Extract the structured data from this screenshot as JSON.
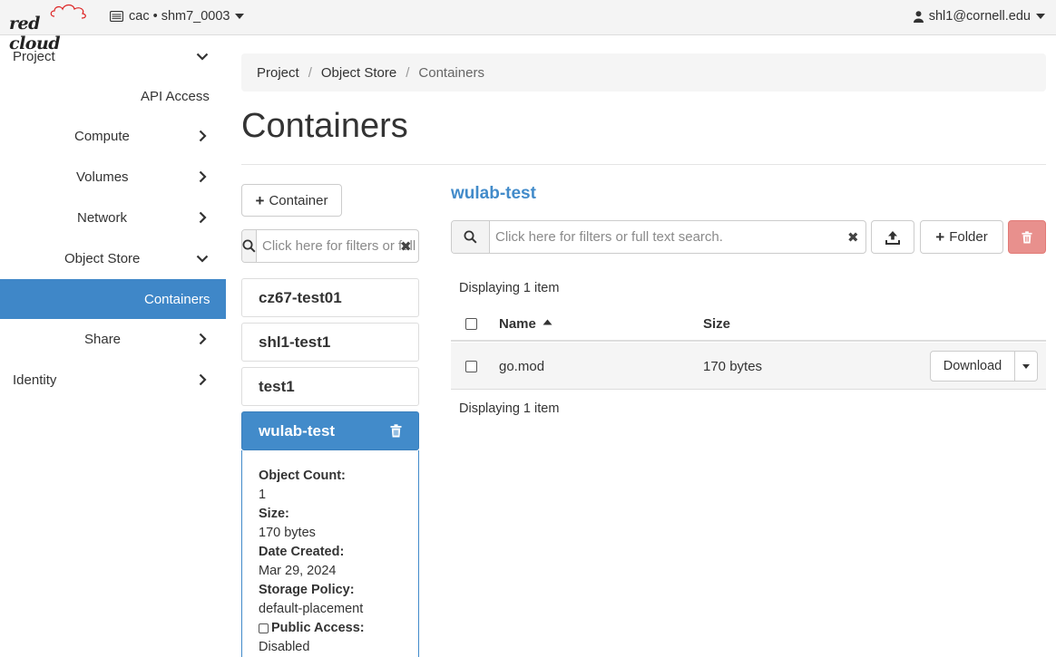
{
  "header": {
    "logo_text": "red cloud",
    "project_switch": "cac • shm7_0003",
    "user": "shl1@cornell.edu"
  },
  "sidebar": {
    "items": [
      {
        "label": "Project",
        "icon": "chevron-down-icon"
      },
      {
        "label": "API Access",
        "icon": ""
      },
      {
        "label": "Compute",
        "icon": "chevron-right-icon"
      },
      {
        "label": "Volumes",
        "icon": "chevron-right-icon"
      },
      {
        "label": "Network",
        "icon": "chevron-right-icon"
      },
      {
        "label": "Object Store",
        "icon": "chevron-down-icon"
      },
      {
        "label": "Containers",
        "icon": "",
        "active": true
      },
      {
        "label": "Share",
        "icon": "chevron-right-icon"
      },
      {
        "label": "Identity",
        "icon": "chevron-right-icon"
      }
    ]
  },
  "breadcrumb": {
    "items": [
      "Project",
      "Object Store",
      "Containers"
    ]
  },
  "page": {
    "title": "Containers"
  },
  "containers_panel": {
    "add_button": "Container",
    "search_placeholder": "Click here for filters or full text search.",
    "items": [
      "cz67-test01",
      "shl1-test1",
      "test1",
      "wulab-test"
    ],
    "selected": "wulab-test",
    "details": {
      "object_count_label": "Object Count:",
      "object_count": "1",
      "size_label": "Size:",
      "size": "170 bytes",
      "date_label": "Date Created:",
      "date": "Mar 29, 2024",
      "policy_label": "Storage Policy:",
      "policy": "default-placement",
      "public_label": "Public Access:",
      "public": "Disabled"
    }
  },
  "objects_panel": {
    "container_name": "wulab-test",
    "search_placeholder": "Click here for filters or full text search.",
    "folder_button": "Folder",
    "count_text_top": "Displaying 1 item",
    "count_text_bottom": "Displaying 1 item",
    "columns": {
      "name": "Name",
      "size": "Size"
    },
    "rows": [
      {
        "name": "go.mod",
        "size": "170 bytes",
        "action": "Download"
      }
    ],
    "colors": {
      "accent": "#428bca",
      "danger": "#e8908d",
      "active_nav": "#3f87c8"
    }
  }
}
